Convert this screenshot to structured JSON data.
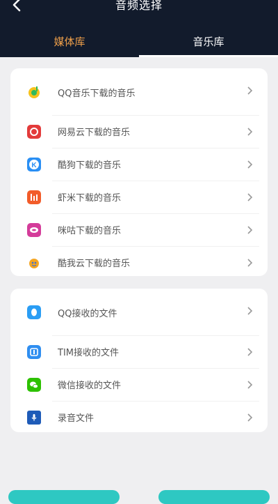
{
  "header": {
    "title": "音频选择"
  },
  "tabs": [
    {
      "label": "媒体库"
    },
    {
      "label": "音乐库"
    }
  ],
  "music_apps": [
    {
      "label": "QQ音乐下载的音乐",
      "icon": "qq-music-icon"
    },
    {
      "label": "网易云下载的音乐",
      "icon": "netease-music-icon"
    },
    {
      "label": "酷狗下载的音乐",
      "icon": "kugou-icon"
    },
    {
      "label": "虾米下载的音乐",
      "icon": "xiami-icon"
    },
    {
      "label": "咪咕下载的音乐",
      "icon": "migu-icon"
    },
    {
      "label": "酷我云下载的音乐",
      "icon": "kuwo-icon"
    }
  ],
  "received_files": [
    {
      "label": "QQ接收的文件",
      "icon": "qq-icon"
    },
    {
      "label": "TIM接收的文件",
      "icon": "tim-icon"
    },
    {
      "label": "微信接收的文件",
      "icon": "wechat-icon"
    },
    {
      "label": "录音文件",
      "icon": "recording-file-icon"
    }
  ],
  "colors": {
    "header_bg": "#121b2c",
    "active_tab": "#f0a04a",
    "accent": "#2ec8c2"
  }
}
